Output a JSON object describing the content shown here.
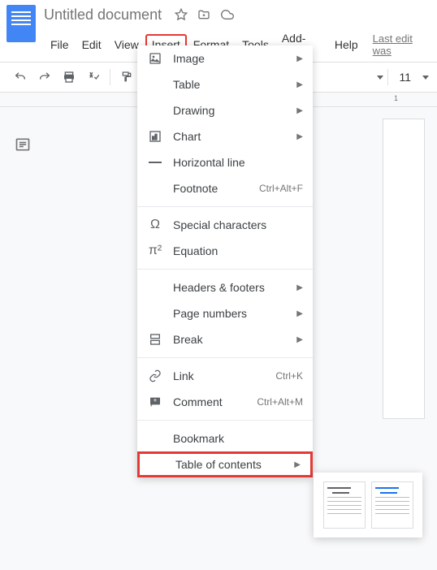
{
  "header": {
    "title": "Untitled document",
    "last_edit": "Last edit was"
  },
  "menubar": {
    "items": [
      "File",
      "Edit",
      "View",
      "Insert",
      "Format",
      "Tools",
      "Add-ons",
      "Help"
    ]
  },
  "toolbar": {
    "font_size": "11"
  },
  "ruler": {
    "mark": "1"
  },
  "dropdown": {
    "image": "Image",
    "table": "Table",
    "drawing": "Drawing",
    "chart": "Chart",
    "horizontal_line": "Horizontal line",
    "footnote": "Footnote",
    "footnote_shortcut": "Ctrl+Alt+F",
    "special_chars": "Special characters",
    "equation": "Equation",
    "headers_footers": "Headers & footers",
    "page_numbers": "Page numbers",
    "break": "Break",
    "link": "Link",
    "link_shortcut": "Ctrl+K",
    "comment": "Comment",
    "comment_shortcut": "Ctrl+Alt+M",
    "bookmark": "Bookmark",
    "toc": "Table of contents"
  }
}
